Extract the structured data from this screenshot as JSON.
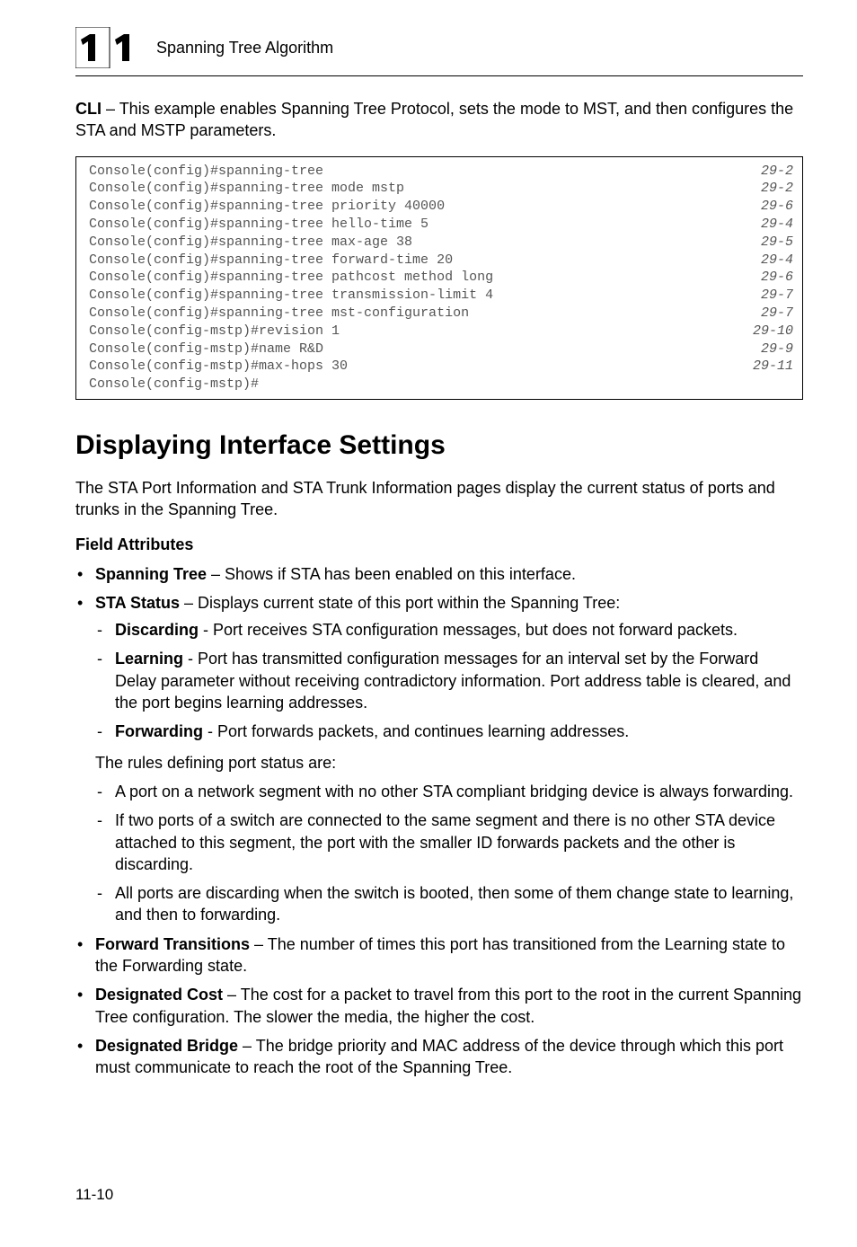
{
  "header": {
    "chapter_svg_label": "11",
    "title": "Spanning Tree Algorithm"
  },
  "intro": {
    "cli_bold": "CLI",
    "cli_rest": " – This example enables Spanning Tree Protocol, sets the mode to MST, and then configures the STA and MSTP parameters."
  },
  "code_lines": [
    {
      "cmd": "Console(config)#spanning-tree",
      "ref": "29-2"
    },
    {
      "cmd": "Console(config)#spanning-tree mode mstp",
      "ref": "29-2"
    },
    {
      "cmd": "Console(config)#spanning-tree priority 40000",
      "ref": "29-6"
    },
    {
      "cmd": "Console(config)#spanning-tree hello-time 5",
      "ref": "29-4"
    },
    {
      "cmd": "Console(config)#spanning-tree max-age 38",
      "ref": "29-5"
    },
    {
      "cmd": "Console(config)#spanning-tree forward-time 20",
      "ref": "29-4"
    },
    {
      "cmd": "Console(config)#spanning-tree pathcost method long",
      "ref": "29-6"
    },
    {
      "cmd": "Console(config)#spanning-tree transmission-limit 4",
      "ref": "29-7"
    },
    {
      "cmd": "Console(config)#spanning-tree mst-configuration",
      "ref": "29-7"
    },
    {
      "cmd": "Console(config-mstp)#revision 1",
      "ref": "29-10"
    },
    {
      "cmd": "Console(config-mstp)#name R&D",
      "ref": "29-9"
    },
    {
      "cmd": "Console(config-mstp)#max-hops 30",
      "ref": "29-11"
    },
    {
      "cmd": "Console(config-mstp)#",
      "ref": ""
    }
  ],
  "section_heading": "Displaying Interface Settings",
  "section_intro": "The STA Port Information and STA Trunk Information pages display the current status of ports and trunks in the Spanning Tree.",
  "field_attributes_label": "Field Attributes",
  "bullets": {
    "b1_bold": "Spanning Tree",
    "b1_rest": " – Shows if STA has been enabled on this interface.",
    "b2_bold": "STA Status",
    "b2_rest": " – Displays current state of this port within the Spanning Tree:",
    "b2_sub": [
      {
        "bold": "Discarding",
        "rest": " - Port receives STA configuration messages, but does not forward packets."
      },
      {
        "bold": "Learning",
        "rest": " - Port has transmitted configuration messages for an interval set by the Forward Delay parameter without receiving contradictory information. Port address table is cleared, and the port begins learning addresses."
      },
      {
        "bold": "Forwarding",
        "rest": " - Port forwards packets, and continues learning addresses."
      }
    ],
    "rules_intro": "The rules defining port status are:",
    "rules": [
      "A port on a network segment with no other STA compliant bridging device is always forwarding.",
      "If two ports of a switch are connected to the same segment and there is no other STA device attached to this segment, the port with the smaller ID forwards packets and the other is discarding.",
      "All ports are discarding when the switch is booted, then some of them change state to learning, and then to forwarding."
    ],
    "b3_bold": "Forward Transitions",
    "b3_rest": " – The number of times this port has transitioned from the Learning state to the Forwarding state.",
    "b4_bold": "Designated Cost",
    "b4_rest": " – The cost for a packet to travel from this port to the root in the current Spanning Tree configuration. The slower the media, the higher the cost.",
    "b5_bold": "Designated Bridge",
    "b5_rest": " – The bridge priority and MAC address of the device through which this port must communicate to reach the root of the Spanning Tree."
  },
  "footer_page": "11-10"
}
